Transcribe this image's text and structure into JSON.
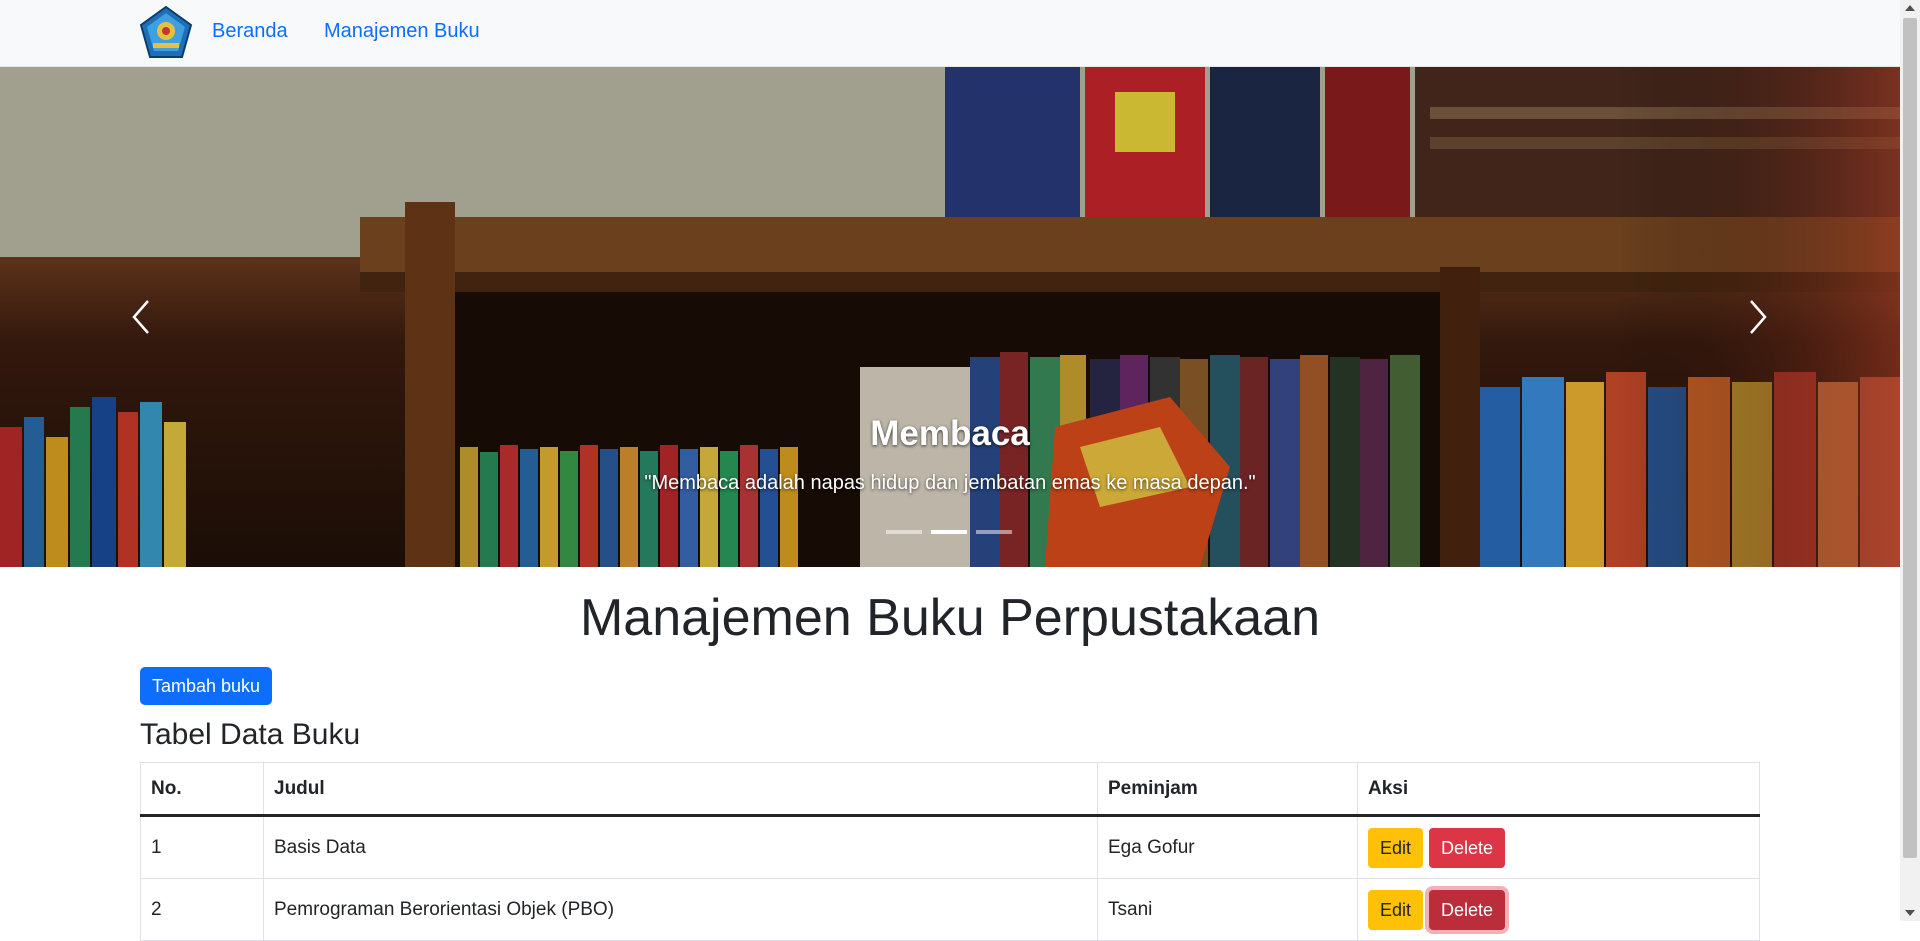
{
  "navbar": {
    "logo": "school-crest-logo",
    "links": [
      "Beranda",
      "Manajemen Buku"
    ]
  },
  "hero": {
    "title": "Membaca",
    "quote": "\"Membaca adalah napas hidup dan jembatan emas ke masa depan.\"",
    "indicators": 3,
    "active_indicator": 2
  },
  "main": {
    "title": "Manajemen Buku Perpustakaan",
    "add_button": "Tambah buku",
    "table_title": "Tabel Data Buku",
    "columns": [
      "No.",
      "Judul",
      "Peminjam",
      "Aksi"
    ],
    "rows": [
      {
        "no": "1",
        "judul": "Basis Data",
        "peminjam": "Ega Gofur",
        "edit": "Edit",
        "delete": "Delete"
      },
      {
        "no": "2",
        "judul": "Pemrograman Berorientasi Objek (PBO)",
        "peminjam": "Tsani",
        "edit": "Edit",
        "delete": "Delete"
      }
    ]
  },
  "colors": {
    "primary": "#0d6efd",
    "warning": "#ffc107",
    "danger": "#dc3545",
    "navbar_bg": "#f8f9fa"
  }
}
